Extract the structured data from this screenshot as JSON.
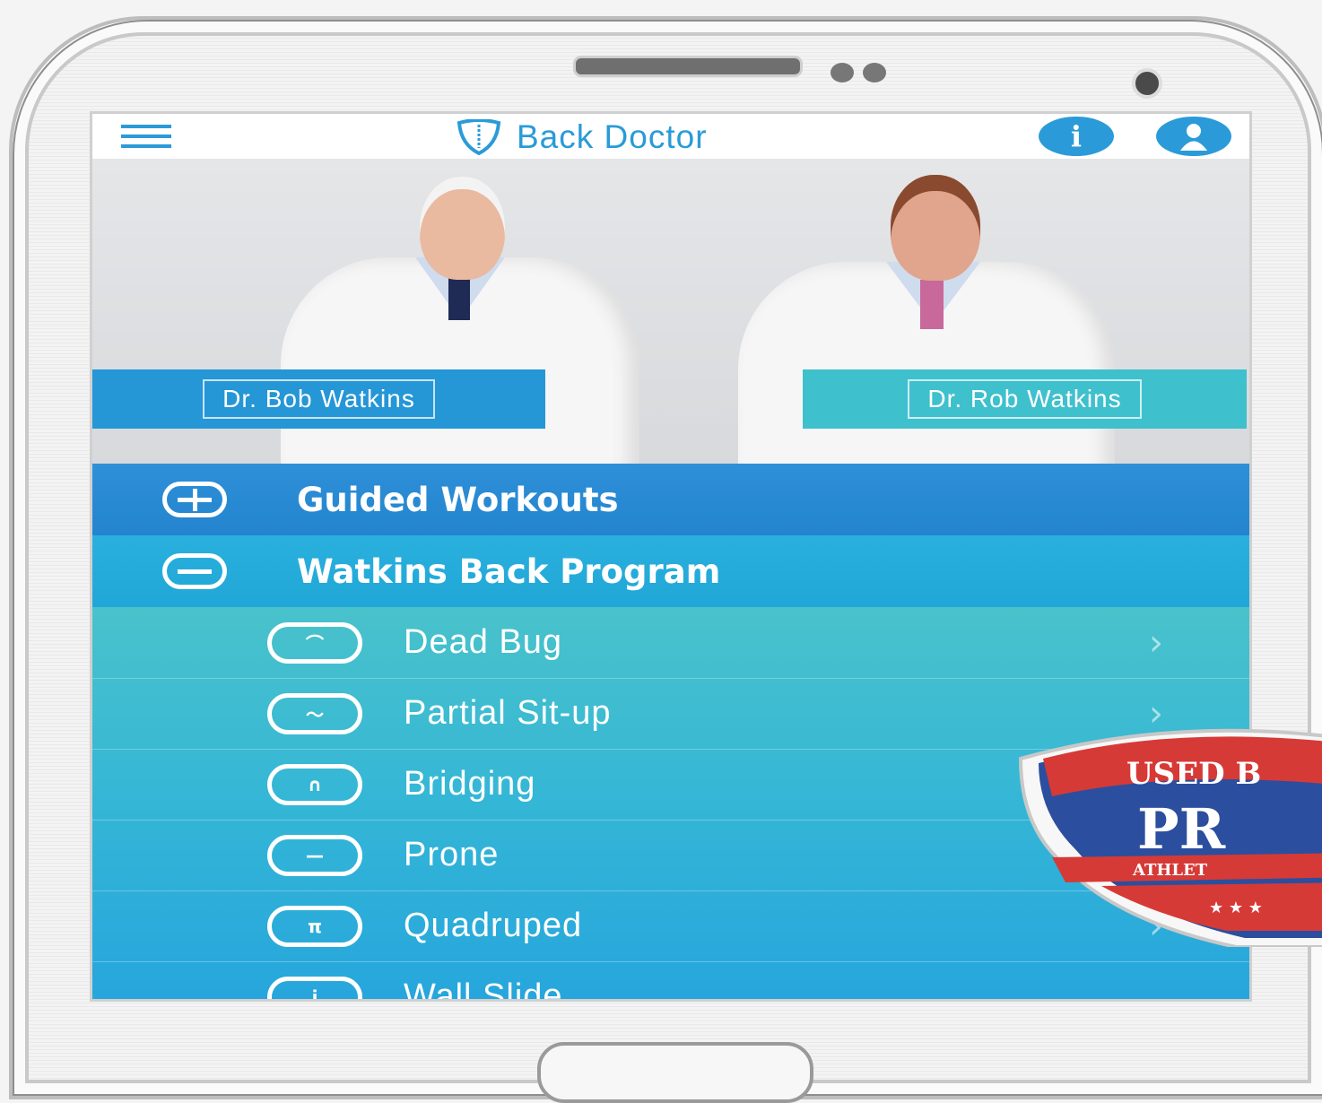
{
  "app": {
    "title": "Back Doctor",
    "accent_color": "#2a9bd8"
  },
  "header": {
    "menu_icon": "hamburger-icon",
    "info_icon": "info-icon",
    "profile_icon": "user-icon"
  },
  "hero": {
    "doctor_left": "Dr. Bob Watkins",
    "doctor_right": "Dr. Rob Watkins"
  },
  "sections": [
    {
      "label": "Guided Workouts",
      "icon": "plus-circle-icon",
      "expanded": false
    },
    {
      "label": "Watkins Back Program",
      "icon": "minus-circle-icon",
      "expanded": true
    }
  ],
  "exercises": [
    {
      "label": "Dead Bug",
      "icon": "dead-bug-icon"
    },
    {
      "label": "Partial Sit-up",
      "icon": "partial-situp-icon"
    },
    {
      "label": "Bridging",
      "icon": "bridging-icon"
    },
    {
      "label": "Prone",
      "icon": "prone-icon"
    },
    {
      "label": "Quadruped",
      "icon": "quadruped-icon"
    },
    {
      "label": "Wall Slide",
      "icon": "wall-slide-icon"
    }
  ],
  "badge": {
    "line1": "USED B",
    "line2": "PR",
    "line3": "ATHLET"
  }
}
